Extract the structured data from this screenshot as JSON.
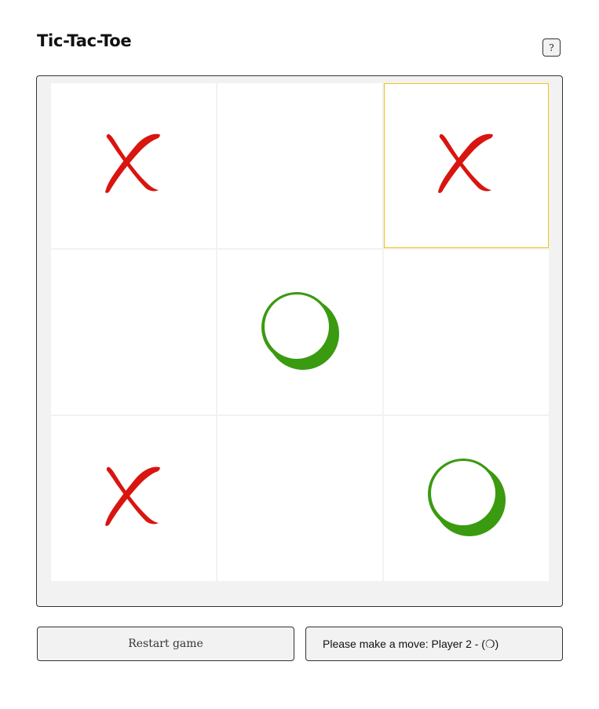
{
  "header": {
    "title": "Tic-Tac-Toe",
    "help_label": "?"
  },
  "board": {
    "cells": [
      "X",
      "",
      "X",
      "",
      "O",
      "",
      "X",
      "",
      "O"
    ],
    "highlighted_cell": 2,
    "colors": {
      "x": "#d8150f",
      "o": "#3a9a10",
      "highlight": "#f0c419"
    }
  },
  "controls": {
    "restart_label": "Restart game",
    "status_text": "Please make a move: Player 2 - (❍)"
  }
}
